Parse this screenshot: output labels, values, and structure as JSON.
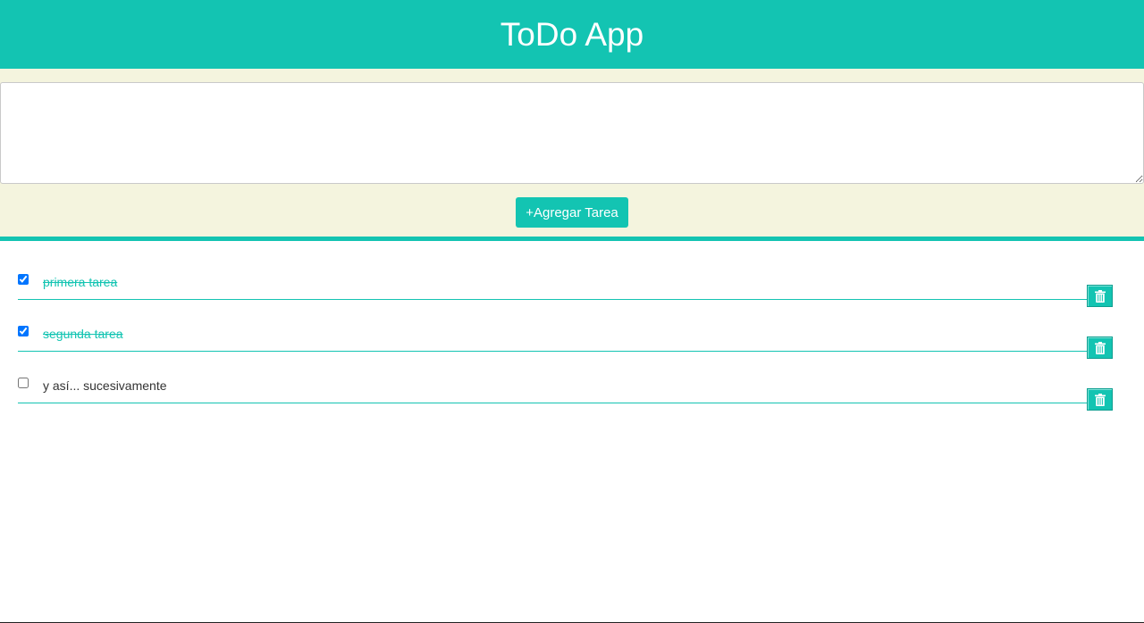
{
  "app": {
    "title": "ToDo App"
  },
  "form": {
    "textarea_value": "",
    "textarea_placeholder": "",
    "add_button_label": "+Agregar Tarea"
  },
  "tasks": [
    {
      "text": "primera tarea",
      "completed": true
    },
    {
      "text": "segunda tarea",
      "completed": true
    },
    {
      "text": "y así... sucesivamente",
      "completed": false
    }
  ],
  "icons": {
    "delete": "trash-icon"
  },
  "colors": {
    "accent": "#13c4b2",
    "panel_background": "#f4f4de",
    "text": "#333333",
    "white": "#ffffff"
  }
}
